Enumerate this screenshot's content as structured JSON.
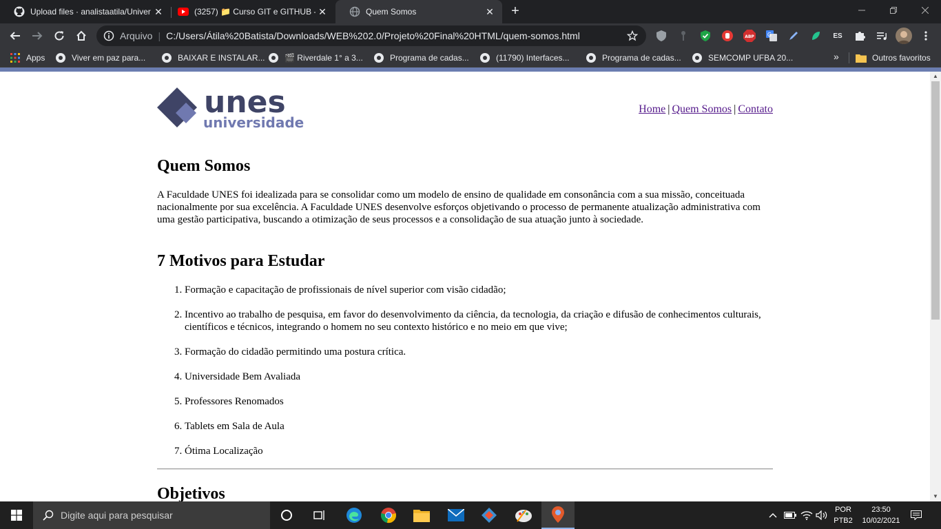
{
  "browser": {
    "tabs": [
      {
        "title": "Upload files · analistaatila/Univer",
        "favicon": "github-icon",
        "active": false
      },
      {
        "title": "(3257) 📁 Curso GIT e GITHUB - ",
        "favicon": "youtube-icon",
        "active": false
      },
      {
        "title": "Quem Somos",
        "favicon": "globe-icon",
        "active": true
      }
    ],
    "new_tab_label": "+",
    "omnibox": {
      "scheme": "Arquivo",
      "separator": "|",
      "url": "C:/Users/Átila%20Batista/Downloads/WEB%202.0/Projeto%20Final%20HTML/quem-somos.html"
    },
    "extensions": [
      "shield-icon",
      "key-icon",
      "shield-check-icon",
      "hand-stop-icon",
      "adblock-icon",
      "translate-icon",
      "pen-icon",
      "leaf-icon",
      "ES",
      "puzzle-icon",
      "playlist-icon",
      "avatar"
    ],
    "bookmarks": [
      {
        "label": "Apps",
        "icon": "apps-grid-icon"
      },
      {
        "label": "Viver em paz para...",
        "icon": "globe-icon"
      },
      {
        "label": "BAIXAR E INSTALAR...",
        "icon": "globe-icon"
      },
      {
        "label": "🎬 Riverdale 1° a 3...",
        "icon": "globe-icon"
      },
      {
        "label": "Programa de cadas...",
        "icon": "globe-icon"
      },
      {
        "label": "(11790) Interfaces...",
        "icon": "globe-icon"
      },
      {
        "label": "Programa de cadas...",
        "icon": "globe-icon"
      },
      {
        "label": "SEMCOMP UFBA 20...",
        "icon": "globe-icon"
      }
    ],
    "bookmarks_more": "»",
    "other_favorites": "Outros favoritos"
  },
  "page": {
    "logo": {
      "brand": "unes",
      "sub": "universidade"
    },
    "nav": {
      "home": "Home",
      "sep1": "|",
      "about": "Quem Somos",
      "sep2": "|",
      "contact": "Contato"
    },
    "about_title": "Quem Somos",
    "about_text": "A Faculdade UNES foi idealizada para se consolidar como um modelo de ensino de qualidade em consonância com a sua missão, conceituada nacionalmente por sua excelência. A Faculdade UNES desenvolve esforços objetivando o processo de permanente atualização administrativa com uma gestão participativa, buscando a otimização de seus processos e a consolidação de sua atuação junto à sociedade.",
    "motivos_title": "7 Motivos para Estudar",
    "motivos": [
      "Formação e capacitação de profissionais de nível superior com visão cidadão;",
      "Incentivo ao trabalho de pesquisa, em favor do desenvolvimento da ciência, da tecnologia, da criação e difusão de conhecimentos culturais, científicos e técnicos, integrando o homem no seu contexto histórico e no meio em que vive;",
      "Formação do cidadão permitindo uma postura crítica.",
      "Universidade Bem Avaliada",
      "Professores Renomados",
      "Tablets em Sala de Aula",
      "Ótima Localização"
    ],
    "objetivos_title": "Objetivos"
  },
  "taskbar": {
    "search_placeholder": "Digite aqui para pesquisar",
    "lang_line1": "POR",
    "lang_line2": "PTB2",
    "time": "23:50",
    "date": "10/02/2021"
  },
  "colors": {
    "logo_dark": "#3f4466",
    "logo_light": "#7079b0",
    "link": "#551a8b",
    "chrome_dark": "#202124",
    "chrome_toolbar": "#35363a"
  }
}
